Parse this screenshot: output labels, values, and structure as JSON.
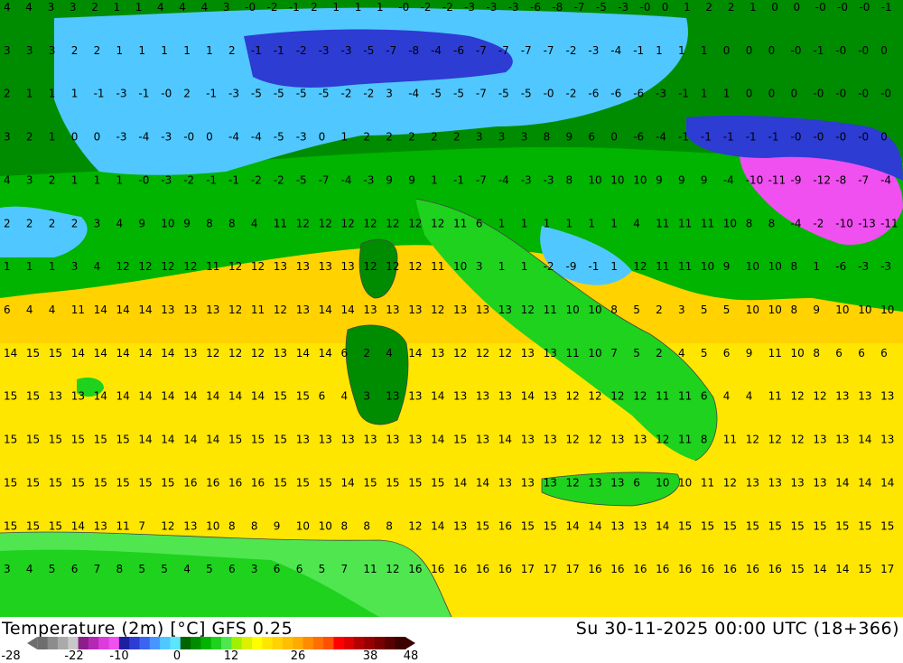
{
  "title_left": "Temperature (2m) [°C] GFS 0.25",
  "title_right": "Su 30-11-2025 00:00 UTC (18+366)",
  "scale": {
    "labels": [
      "-28",
      "-22",
      "-10",
      "0",
      "12",
      "26",
      "38",
      "48"
    ],
    "colors": [
      "#6e6e6e",
      "#8c8c8c",
      "#aaaaaa",
      "#c8c8c8",
      "#8c1e8c",
      "#b428b4",
      "#dc3cdc",
      "#f050f0",
      "#1e1ea0",
      "#2d3cd2",
      "#3c64f0",
      "#4696ff",
      "#50c8ff",
      "#5ae6ff",
      "#006400",
      "#008c00",
      "#00b400",
      "#1ed21e",
      "#50e650",
      "#a0f000",
      "#dcf000",
      "#ffff00",
      "#ffe600",
      "#ffd200",
      "#ffbe00",
      "#ffaa00",
      "#ff8c00",
      "#ff6e00",
      "#ff5000",
      "#ff0000",
      "#dc0000",
      "#b40000",
      "#960000",
      "#780000",
      "#5a0000",
      "#3c0000"
    ]
  },
  "regions": {
    "land": "Italy and surrounding Mediterranean",
    "colors": {
      "cold": "#1e1ea0",
      "cool": "#50c8ff",
      "mild": "#00b400",
      "warm": "#ffd200",
      "very_cold": "#f050f0"
    }
  },
  "value_rows": [
    [
      "4",
      "4",
      "3",
      "3",
      "2",
      "1",
      "1",
      "4",
      "4",
      "4",
      "3",
      "-0",
      "-2",
      "-1",
      "2",
      "1",
      "1",
      "1",
      "-0",
      "-2",
      "-2",
      "-3",
      "-3",
      "-3",
      "-6",
      "-8",
      "-7",
      "-5",
      "-3",
      "-0",
      "0",
      "1",
      "2",
      "2",
      "1",
      "0",
      "0",
      "-0",
      "-0",
      "-0",
      "-1"
    ],
    [
      "3",
      "3",
      "3",
      "2",
      "2",
      "1",
      "1",
      "1",
      "1",
      "1",
      "2",
      "-1",
      "-1",
      "-2",
      "-3",
      "-3",
      "-5",
      "-7",
      "-8",
      "-4",
      "-6",
      "-7",
      "-7",
      "-7",
      "-7",
      "-2",
      "-3",
      "-4",
      "-1",
      "1",
      "1",
      "1",
      "0",
      "0",
      "0",
      "-0",
      "-1",
      "-0",
      "-0",
      "0"
    ],
    [
      "2",
      "1",
      "1",
      "1",
      "-1",
      "-3",
      "-1",
      "-0",
      "2",
      "-1",
      "-3",
      "-5",
      "-5",
      "-5",
      "-5",
      "-2",
      "-2",
      "3",
      "-4",
      "-5",
      "-5",
      "-7",
      "-5",
      "-5",
      "-0",
      "-2",
      "-6",
      "-6",
      "-6",
      "-3",
      "-1",
      "1",
      "1",
      "0",
      "0",
      "0",
      "-0",
      "-0",
      "-0",
      "-0"
    ],
    [
      "3",
      "2",
      "1",
      "0",
      "0",
      "-3",
      "-4",
      "-3",
      "-0",
      "0",
      "-4",
      "-4",
      "-5",
      "-3",
      "0",
      "1",
      "2",
      "2",
      "2",
      "2",
      "2",
      "3",
      "3",
      "3",
      "8",
      "9",
      "6",
      "0",
      "-6",
      "-4",
      "-1",
      "-1",
      "-1",
      "-1",
      "-1",
      "-0",
      "-0",
      "-0",
      "-0",
      "0"
    ],
    [
      "4",
      "3",
      "2",
      "1",
      "1",
      "1",
      "-0",
      "-3",
      "-2",
      "-1",
      "-1",
      "-2",
      "-2",
      "-5",
      "-7",
      "-4",
      "-3",
      "9",
      "9",
      "1",
      "-1",
      "-7",
      "-4",
      "-3",
      "-3",
      "8",
      "10",
      "10",
      "10",
      "9",
      "9",
      "9",
      "-4",
      "-10",
      "-11",
      "-9",
      "-12",
      "-8",
      "-7",
      "-4"
    ],
    [
      "2",
      "2",
      "2",
      "2",
      "3",
      "4",
      "9",
      "10",
      "9",
      "8",
      "8",
      "4",
      "11",
      "12",
      "12",
      "12",
      "12",
      "12",
      "12",
      "12",
      "11",
      "6",
      "1",
      "1",
      "1",
      "1",
      "1",
      "1",
      "4",
      "11",
      "11",
      "11",
      "10",
      "8",
      "8",
      "-4",
      "-2",
      "-10",
      "-13",
      "-11"
    ],
    [
      "1",
      "1",
      "1",
      "3",
      "4",
      "12",
      "12",
      "12",
      "12",
      "11",
      "12",
      "12",
      "13",
      "13",
      "13",
      "13",
      "12",
      "12",
      "12",
      "11",
      "10",
      "3",
      "1",
      "1",
      "-2",
      "-9",
      "-1",
      "1",
      "12",
      "11",
      "11",
      "10",
      "9",
      "10",
      "10",
      "8",
      "1",
      "-6",
      "-3",
      "-3"
    ],
    [
      "6",
      "4",
      "4",
      "11",
      "14",
      "14",
      "14",
      "13",
      "13",
      "13",
      "12",
      "11",
      "12",
      "13",
      "14",
      "14",
      "13",
      "13",
      "13",
      "12",
      "13",
      "13",
      "13",
      "12",
      "11",
      "10",
      "10",
      "8",
      "5",
      "2",
      "3",
      "5",
      "5",
      "10",
      "10",
      "8",
      "9",
      "10",
      "10",
      "10"
    ],
    [
      "14",
      "15",
      "15",
      "14",
      "14",
      "14",
      "14",
      "14",
      "13",
      "12",
      "12",
      "12",
      "13",
      "14",
      "14",
      "6",
      "2",
      "4",
      "14",
      "13",
      "12",
      "12",
      "12",
      "13",
      "13",
      "11",
      "10",
      "7",
      "5",
      "2",
      "4",
      "5",
      "6",
      "9",
      "11",
      "10",
      "8",
      "6",
      "6",
      "6"
    ],
    [
      "15",
      "15",
      "13",
      "13",
      "14",
      "14",
      "14",
      "14",
      "14",
      "14",
      "14",
      "14",
      "15",
      "15",
      "6",
      "4",
      "3",
      "13",
      "13",
      "14",
      "13",
      "13",
      "13",
      "14",
      "13",
      "12",
      "12",
      "12",
      "12",
      "11",
      "11",
      "6",
      "4",
      "4",
      "11",
      "12",
      "12",
      "13",
      "13",
      "13"
    ],
    [
      "15",
      "15",
      "15",
      "15",
      "15",
      "15",
      "14",
      "14",
      "14",
      "14",
      "15",
      "15",
      "15",
      "13",
      "13",
      "13",
      "13",
      "13",
      "13",
      "14",
      "15",
      "13",
      "14",
      "13",
      "13",
      "12",
      "12",
      "13",
      "13",
      "12",
      "11",
      "8",
      "11",
      "12",
      "12",
      "12",
      "13",
      "13",
      "14",
      "13"
    ],
    [
      "15",
      "15",
      "15",
      "15",
      "15",
      "15",
      "15",
      "15",
      "16",
      "16",
      "16",
      "16",
      "15",
      "15",
      "15",
      "14",
      "15",
      "15",
      "15",
      "15",
      "14",
      "14",
      "13",
      "13",
      "13",
      "12",
      "13",
      "13",
      "6",
      "10",
      "10",
      "11",
      "12",
      "13",
      "13",
      "13",
      "13",
      "14",
      "14",
      "14"
    ],
    [
      "15",
      "15",
      "15",
      "14",
      "13",
      "11",
      "7",
      "12",
      "13",
      "10",
      "8",
      "8",
      "9",
      "10",
      "10",
      "8",
      "8",
      "8",
      "12",
      "14",
      "13",
      "15",
      "16",
      "15",
      "15",
      "14",
      "14",
      "13",
      "13",
      "14",
      "15",
      "15",
      "15",
      "15",
      "15",
      "15",
      "15",
      "15",
      "15",
      "15"
    ],
    [
      "3",
      "4",
      "5",
      "6",
      "7",
      "8",
      "5",
      "5",
      "4",
      "5",
      "6",
      "3",
      "6",
      "6",
      "5",
      "7",
      "11",
      "12",
      "16",
      "16",
      "16",
      "16",
      "16",
      "17",
      "17",
      "17",
      "16",
      "16",
      "16",
      "16",
      "16",
      "16",
      "16",
      "16",
      "16",
      "15",
      "14",
      "14",
      "15",
      "17"
    ]
  ]
}
